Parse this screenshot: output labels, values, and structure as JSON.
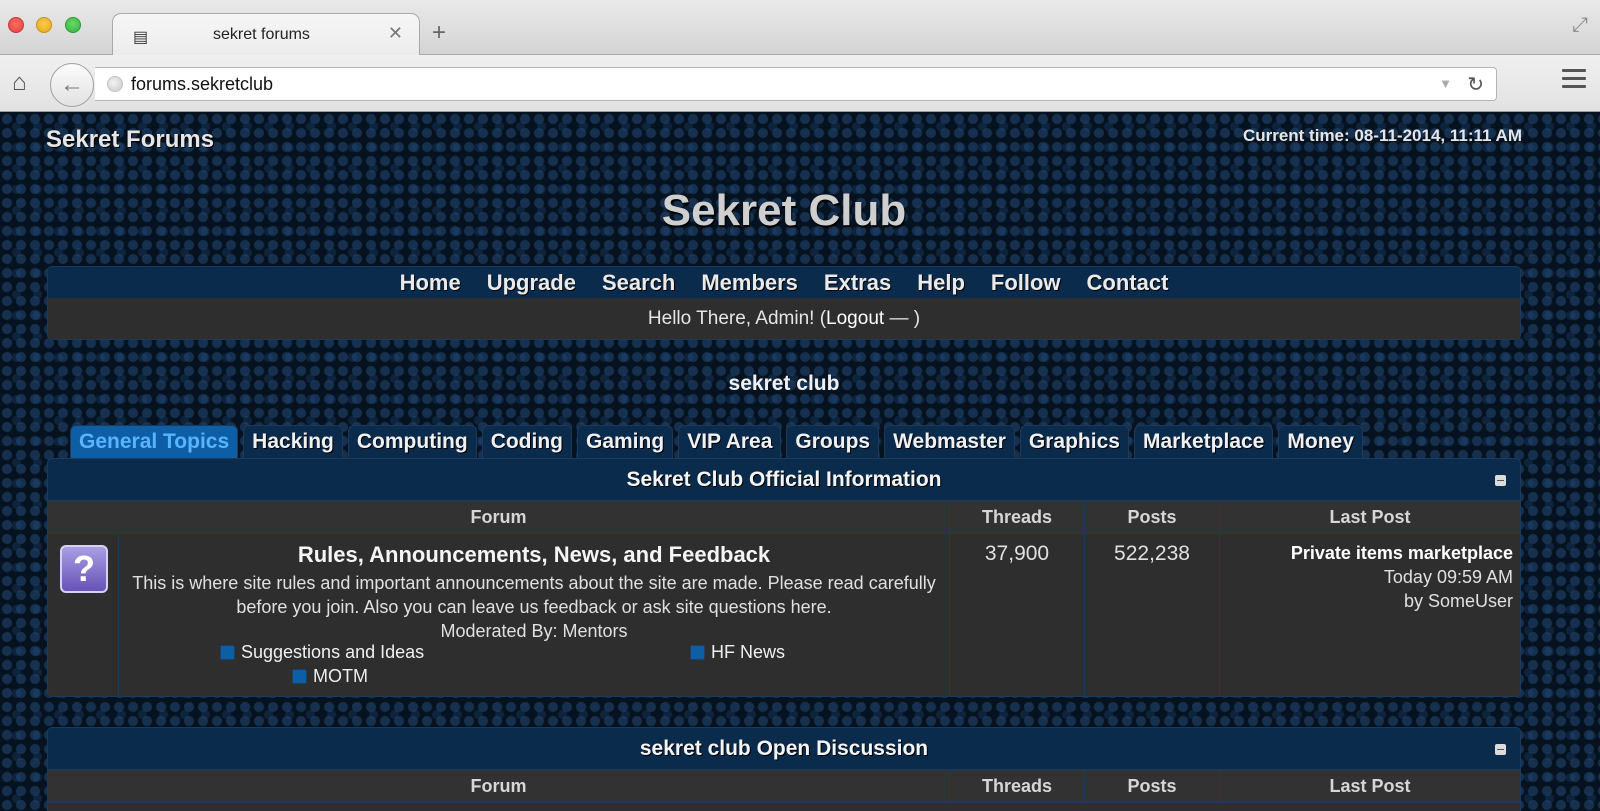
{
  "browser": {
    "tab_title": "sekret forums",
    "url": "forums.sekretclub",
    "icons": {
      "tab": "laptop-icon",
      "close": "close-icon",
      "new_tab": "plus-icon",
      "home": "home-icon",
      "back": "back-arrow-icon",
      "site": "globe-icon",
      "dropdown": "dropdown-icon",
      "reload": "reload-icon",
      "menu": "hamburger-menu-icon",
      "fullscreen": "fullscreen-icon"
    }
  },
  "header": {
    "site_name": "Sekret Forums",
    "current_time": "Current time: 08-11-2014, 11:11 AM",
    "logo_text": "Sekret Club"
  },
  "menu": {
    "links": [
      "Home",
      "Upgrade",
      "Search",
      "Members",
      "Extras",
      "Help",
      "Follow",
      "Contact"
    ],
    "greeting": "Hello There, Admin! (",
    "logout": "Logout",
    "greeting_end": " — )"
  },
  "subtitle": "sekret club",
  "category_tabs": {
    "active": "General Topics",
    "items": [
      "General Topics",
      "Hacking",
      "Computing",
      "Coding",
      "Gaming",
      "VIP Area",
      "Groups",
      "Webmaster",
      "Graphics",
      "Marketplace",
      "Money"
    ]
  },
  "tables": [
    {
      "title": "Sekret Club Official Information",
      "columns": [
        "Forum",
        "Threads",
        "Posts",
        "Last Post"
      ],
      "forums": [
        {
          "icon": "question-mark-icon",
          "name": "Rules, Announcements, News, and Feedback",
          "description": "This is where site rules and important announcements about the site are made. Please read carefully before you join. Also you can leave us feedback or ask site questions here.",
          "moderated_by": "Moderated By: Mentors",
          "subforums": [
            "Suggestions and Ideas",
            "HF News",
            "MOTM"
          ],
          "threads": "37,900",
          "posts": "522,238",
          "last_post": {
            "title": "Private items marketplace",
            "time": "Today 09:59 AM",
            "by": "by SomeUser"
          }
        }
      ]
    },
    {
      "title": "sekret club Open Discussion",
      "columns": [
        "Forum",
        "Threads",
        "Posts",
        "Last Post"
      ]
    }
  ],
  "colors": {
    "header_blue": "#0b2b4c",
    "active_tab": "#0e5ea6",
    "panel_gray": "#2e2e2e"
  }
}
